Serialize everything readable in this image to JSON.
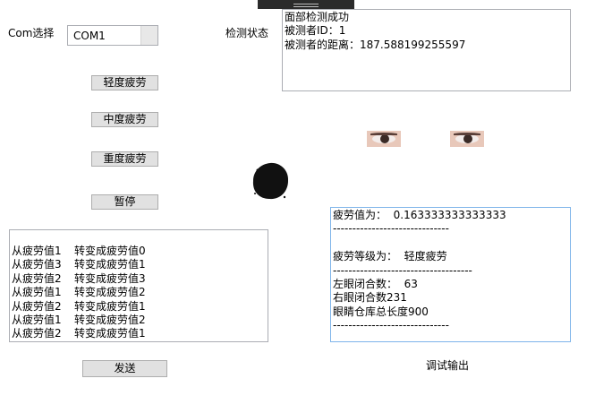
{
  "com": {
    "label": "Com选择",
    "selected": "COM1"
  },
  "detect": {
    "label": "检测状态",
    "lines": [
      "面部检测成功",
      "被测者ID：1",
      "被测者的距离：187.588199255597"
    ]
  },
  "buttons": {
    "mild": "轻度疲劳",
    "moderate": "中度疲劳",
    "severe": "重度疲劳",
    "pause": "暂停",
    "send": "发送"
  },
  "transitions": [
    {
      "from": "从疲劳值1",
      "to": "转变成疲劳值0"
    },
    {
      "from": "从疲劳值3",
      "to": "转变成疲劳值1"
    },
    {
      "from": "从疲劳值2",
      "to": "转变成疲劳值3"
    },
    {
      "from": "从疲劳值1",
      "to": "转变成疲劳值2"
    },
    {
      "from": "从疲劳值2",
      "to": "转变成疲劳值1"
    },
    {
      "from": "从疲劳值1",
      "to": "转变成疲劳值2"
    },
    {
      "from": "从疲劳值2",
      "to": "转变成疲劳值1"
    }
  ],
  "debug": {
    "label": "调试输出",
    "lines": [
      "疲劳值为：  0.163333333333333",
      "------------------------------",
      "",
      "疲劳等级为：  轻度疲劳",
      "------------------------------------",
      "左眼闭合数：  63",
      "右眼闭合数231",
      "眼睛仓库总长度900",
      "------------------------------"
    ]
  }
}
